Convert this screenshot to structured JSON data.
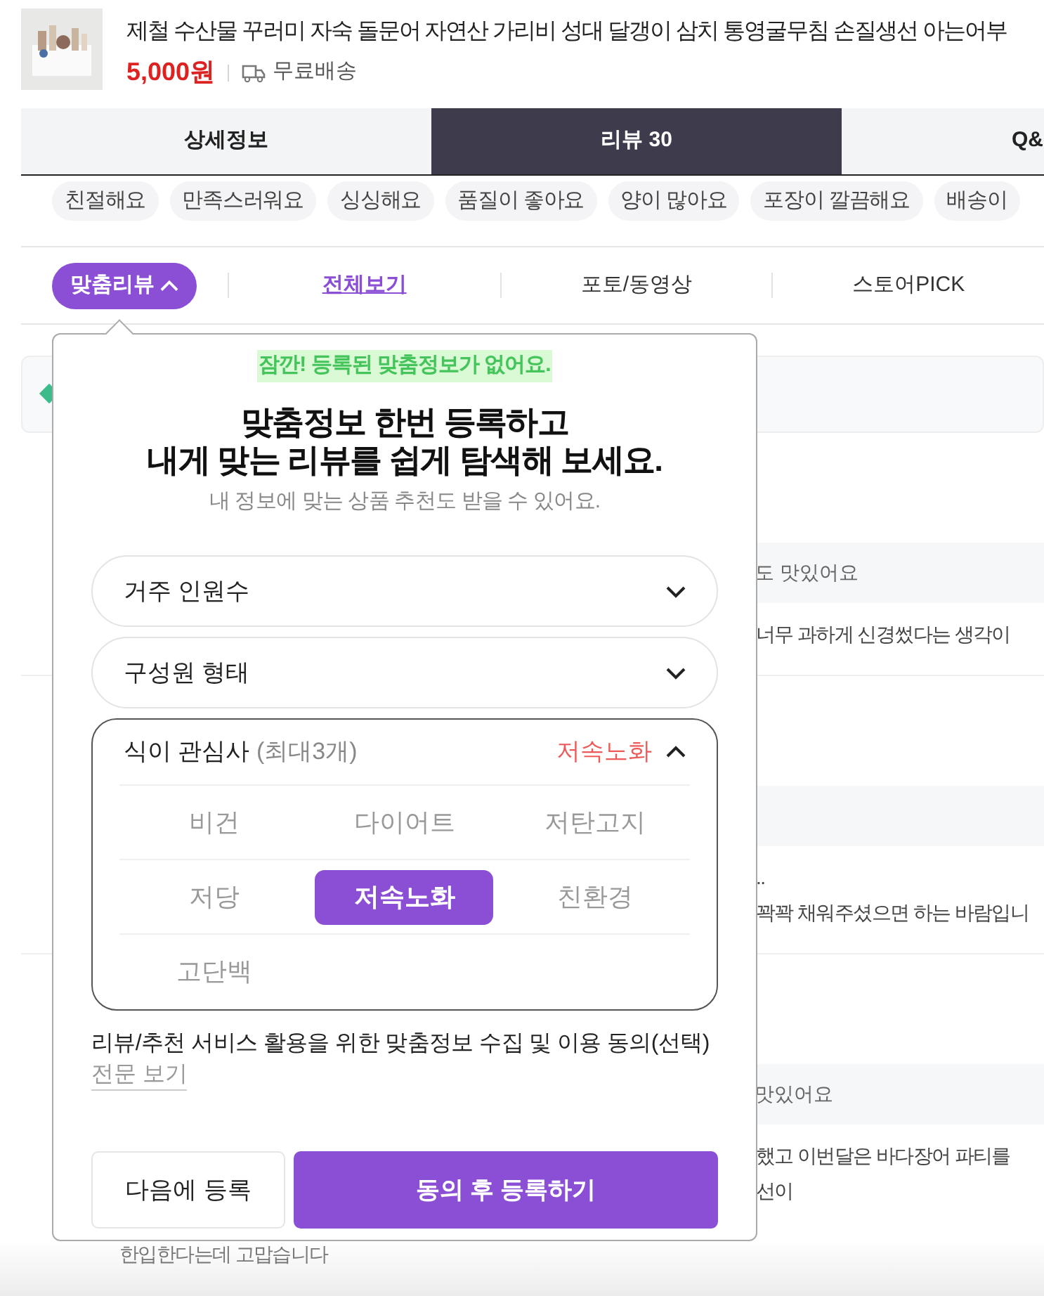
{
  "product": {
    "title": "제철 수산물 꾸러미 자숙 돌문어 자연산 가리비 성대 달갱이 삼치 통영굴무침 손질생선 아는어부",
    "price": "5,000원",
    "shipping": "무료배송"
  },
  "tabs": [
    {
      "label": "상세정보",
      "selected": false
    },
    {
      "label": "리뷰 30",
      "selected": true
    },
    {
      "label": "Q&",
      "selected": false
    }
  ],
  "tags": [
    "친절해요",
    "만족스러워요",
    "싱싱해요",
    "품질이 좋아요",
    "양이 많아요",
    "포장이 깔끔해요",
    "배송이"
  ],
  "filters": [
    {
      "label": "맞춤리뷰",
      "kind": "pill",
      "selected": true
    },
    {
      "label": "전체보기",
      "kind": "link",
      "selected": true
    },
    {
      "label": "포토/동영상",
      "kind": "link",
      "selected": false
    },
    {
      "label": "스토어PICK",
      "kind": "link",
      "selected": false
    }
  ],
  "background_reviews": [
    {
      "highlight": "도 맛있어요",
      "lines": [
        "너무 과하게 신경썼다는 생각이"
      ]
    },
    {
      "lines": [
        "..",
        "꽉꽉 채워주셨으면 하는 바람입니"
      ]
    },
    {
      "highlight": "맛있어요",
      "lines": [
        "했고 이번달은 바다장어 파티를",
        "선이",
        "한입한다는데 고맙습니다"
      ]
    }
  ],
  "popup": {
    "notice": "잠깐! 등록된 맞춤정보가 없어요.",
    "heading": [
      "맞춤정보 한번 등록하고",
      "내게 맞는 리뷰를 쉽게 탐색해 보세요."
    ],
    "subtext": "내 정보에 맞는 상품 추천도 받을 수 있어요.",
    "selects": [
      {
        "label": "거주 인원수",
        "expanded": false
      },
      {
        "label": "구성원 형태",
        "expanded": false
      }
    ],
    "diet": {
      "label": "식이 관심사",
      "hint": "(최대3개)",
      "chosen": "저속노화",
      "expanded": true,
      "options": [
        {
          "label": "비건",
          "selected": false
        },
        {
          "label": "다이어트",
          "selected": false
        },
        {
          "label": "저탄고지",
          "selected": false
        },
        {
          "label": "저당",
          "selected": false
        },
        {
          "label": "저속노화",
          "selected": true
        },
        {
          "label": "친환경",
          "selected": false
        },
        {
          "label": "고단백",
          "selected": false
        }
      ]
    },
    "consent": "리뷰/추천 서비스 활용을 위한 맞춤정보 수집 및 이용 동의(선택)",
    "consent_link": "전문 보기",
    "buttons": [
      {
        "label": "다음에 등록",
        "kind": "secondary"
      },
      {
        "label": "동의 후 등록하기",
        "kind": "primary"
      }
    ]
  }
}
